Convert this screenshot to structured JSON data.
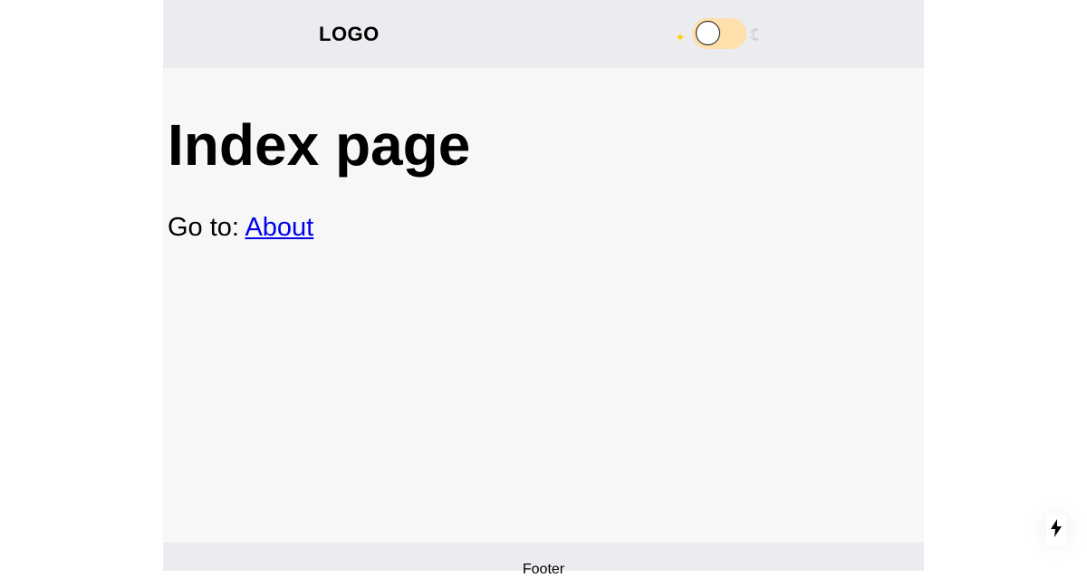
{
  "header": {
    "logo": "LOGO",
    "theme_toggle": {
      "state": "light",
      "icons": [
        "sun-icon",
        "moon-icon"
      ]
    }
  },
  "main": {
    "title": "Index page",
    "nav_prefix": "Go to: ",
    "nav_link_label": "About"
  },
  "footer": {
    "text": "Footer"
  },
  "dev_indicator": {
    "icon": "lightning-bolt-icon"
  },
  "colors": {
    "page_background": "#f7f7f7",
    "outer_background": "#ffffff",
    "header_footer_background": "#ebecf0",
    "toggle_track": "#ffdfab",
    "sun": "#ffd000",
    "moon": "#c8c8c8",
    "link": "#0000ee",
    "text": "#000000"
  }
}
